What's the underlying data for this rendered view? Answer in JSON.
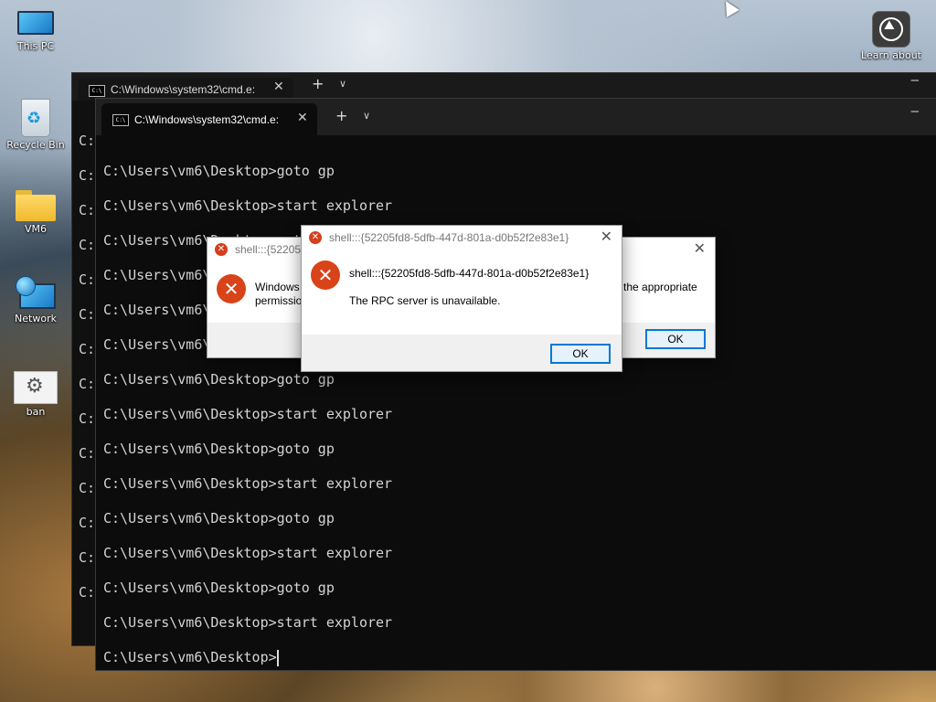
{
  "desktop": {
    "icons": [
      {
        "label": "This PC",
        "icon": "monitor-icon"
      },
      {
        "label": "Recycle Bin",
        "icon": "recycle-bin-icon"
      },
      {
        "label": "VM6",
        "icon": "folder-icon"
      },
      {
        "label": "Network",
        "icon": "network-icon"
      },
      {
        "label": "ban",
        "icon": "settings-file-icon"
      },
      {
        "label": "Learn about",
        "icon": "learn-about-icon"
      }
    ]
  },
  "terminal_back": {
    "tab_title": "C:\\Windows\\system32\\cmd.e:",
    "prompt_fragment": "C:"
  },
  "terminal_front": {
    "tab_title": "C:\\Windows\\system32\\cmd.e:",
    "lines": [
      "C:\\Users\\vm6\\Desktop>goto gp",
      "C:\\Users\\vm6\\Desktop>start explorer",
      "C:\\Users\\vm6\\Desktop>goto gp",
      "C:\\Users\\vm6\\Desktop>start explorer",
      "C:\\Users\\vm6\\Desktop>goto gp",
      "C:\\Users\\vm6\\Desktop>start explorer",
      "C:\\Users\\vm6\\Desktop>goto gp",
      "C:\\Users\\vm6\\Desktop>start explorer",
      "C:\\Users\\vm6\\Desktop>goto gp",
      "C:\\Users\\vm6\\Desktop>start explorer",
      "C:\\Users\\vm6\\Desktop>goto gp",
      "C:\\Users\\vm6\\Desktop>start explorer",
      "C:\\Users\\vm6\\Desktop>goto gp",
      "C:\\Users\\vm6\\Desktop>start explorer"
    ],
    "current_prompt": "C:\\Users\\vm6\\Desktop>"
  },
  "dialog_back": {
    "title": "shell:::{52205f",
    "message_left": "Windows",
    "message_left2": "permissio",
    "message_right": "the appropriate",
    "ok_label": "OK"
  },
  "dialog_front": {
    "title": "shell:::{52205fd8-5dfb-447d-801a-d0b52f2e83e1}",
    "message_title": "shell:::{52205fd8-5dfb-447d-801a-d0b52f2e83e1}",
    "message": "The RPC server is unavailable.",
    "ok_label": "OK"
  },
  "colors": {
    "terminal_bg": "#0c0c0c",
    "error_red": "#d9431a",
    "button_accent": "#0078d7"
  }
}
